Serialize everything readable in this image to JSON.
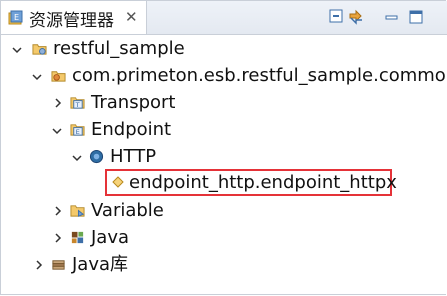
{
  "tab": {
    "title": "资源管理器",
    "close_glyph": "✕"
  },
  "toolbar": {
    "collapse_icon": "collapse-all-icon",
    "link_icon": "link-with-editor-icon"
  },
  "tree": [
    {
      "label": "restful_sample",
      "icon": "project-folder-icon",
      "expanded": true
    },
    {
      "label": "com.primeton.esb.restful_sample.common",
      "icon": "package-folder-icon",
      "expanded": true
    },
    {
      "label": "Transport",
      "icon": "transport-icon",
      "expanded": false
    },
    {
      "label": "Endpoint",
      "icon": "endpoint-icon",
      "expanded": true
    },
    {
      "label": "HTTP",
      "icon": "http-icon",
      "expanded": true
    },
    {
      "label": "endpoint_http.endpoint_httpx",
      "icon": "endpoint-file-icon",
      "selected": true
    },
    {
      "label": "Variable",
      "icon": "variable-folder-icon",
      "expanded": false
    },
    {
      "label": "Java",
      "icon": "java-package-icon",
      "expanded": false
    },
    {
      "label": "Java库",
      "icon": "java-library-icon",
      "expanded": false
    }
  ],
  "colors": {
    "highlight_border": "#e53238",
    "tab_bg": "#ffffff",
    "tabbar_bg": "#e8edf4"
  }
}
